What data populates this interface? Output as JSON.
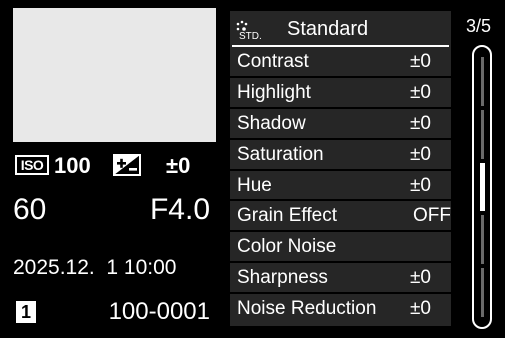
{
  "info": {
    "iso_label": "ISO",
    "iso_value": "100",
    "exposure_icon": "exposure-compensation-icon",
    "exposure_value": "±0",
    "shutter_speed": "60",
    "aperture": "F4.0",
    "date_time": "2025.12.  1 10:00",
    "card_slot": "1",
    "file_number": "100-0001"
  },
  "settings": {
    "style_icon": "standard-photo-style-icon",
    "style_icon_text": "STD.",
    "title": "Standard",
    "rows": [
      {
        "label": "Contrast",
        "value": "±0"
      },
      {
        "label": "Highlight",
        "value": "±0"
      },
      {
        "label": "Shadow",
        "value": "±0"
      },
      {
        "label": "Saturation",
        "value": "±0"
      },
      {
        "label": "Hue",
        "value": "±0"
      },
      {
        "label": "Grain Effect",
        "value": "OFF"
      },
      {
        "label": "Color Noise",
        "value": ""
      },
      {
        "label": "Sharpness",
        "value": "±0"
      },
      {
        "label": "Noise Reduction",
        "value": "±0"
      }
    ]
  },
  "pager": {
    "label": "3/5",
    "current_page": 3,
    "total_pages": 5
  },
  "colors": {
    "background": "#000000",
    "panel": "#262626",
    "text": "#ffffff",
    "thumbnail": "#e8e8e8"
  }
}
